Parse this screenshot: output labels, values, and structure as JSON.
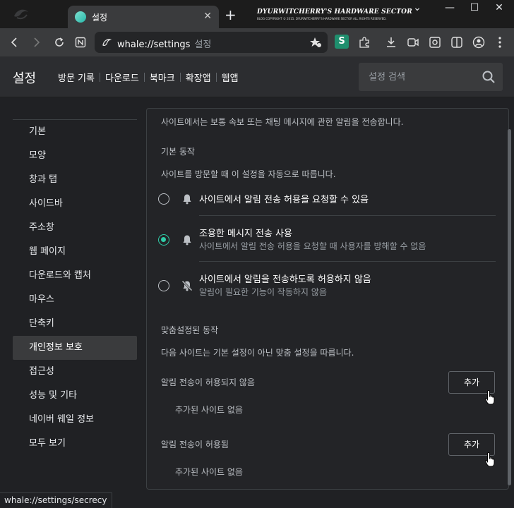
{
  "browser": {
    "tab_title": "설정",
    "new_tab": "+",
    "blog_banner_title": "DYURWITCHERRY'S HARDWARE SECTOR",
    "blog_banner_subtitle": "BLOG COPYRIGHT © 2015. DYURWITCHERRY'S HARDWARE SECTOR ALL RIGHTS RESERVED.",
    "url": "whale://settings",
    "url_hint": "설정",
    "ext_letter": "S",
    "status_url": "whale://settings/secrecy"
  },
  "header": {
    "title": "설정",
    "nav": [
      "방문 기록",
      "다운로드",
      "북마크",
      "확장앱",
      "웹앱"
    ],
    "search_placeholder": "설정 검색"
  },
  "sidebar": {
    "items": [
      {
        "label": "기본",
        "active": false
      },
      {
        "label": "모양",
        "active": false
      },
      {
        "label": "창과 탭",
        "active": false
      },
      {
        "label": "사이드바",
        "active": false
      },
      {
        "label": "주소창",
        "active": false
      },
      {
        "label": "웹 페이지",
        "active": false
      },
      {
        "label": "다운로드와 캡처",
        "active": false
      },
      {
        "label": "마우스",
        "active": false
      },
      {
        "label": "단축키",
        "active": false
      },
      {
        "label": "개인정보 보호",
        "active": true
      },
      {
        "label": "접근성",
        "active": false
      },
      {
        "label": "성능 및 기타",
        "active": false
      },
      {
        "label": "네이버 웨일 정보",
        "active": false
      },
      {
        "label": "모두 보기",
        "active": false
      }
    ]
  },
  "panel": {
    "intro": "사이트에서는 보통 속보 또는 채팅 메시지에 관한 알림을 전송합니다.",
    "default_behavior_title": "기본 동작",
    "default_behavior_desc": "사이트를 방문할 때 이 설정을 자동으로 따릅니다.",
    "options": [
      {
        "title": "사이트에서 알림 전송 허용을 요청할 수 있음",
        "desc": "",
        "checked": false,
        "icon": "bell-icon"
      },
      {
        "title": "조용한 메시지 전송 사용",
        "desc": "사이트에서 알림 전송 허용을 요청할 때 사용자를 방해할 수 없음",
        "checked": true,
        "icon": "bell-icon"
      },
      {
        "title": "사이트에서 알림을 전송하도록 허용하지 않음",
        "desc": "알림이 필요한 기능이 작동하지 않음",
        "checked": false,
        "icon": "bell-off-icon"
      }
    ],
    "custom_title": "맞춤설정된 동작",
    "custom_desc": "다음 사이트는 기본 설정이 아닌 맞춤 설정을 따릅니다.",
    "blocked": {
      "label": "알림 전송이 허용되지 않음",
      "button": "추가",
      "empty": "추가된 사이트 없음"
    },
    "allowed": {
      "label": "알림 전송이 허용됨",
      "button": "추가",
      "empty": "추가된 사이트 없음"
    }
  },
  "colors": {
    "accent": "#2fcca7",
    "background": "#202124",
    "panel": "#232427",
    "toolbar": "#3a3b3d"
  }
}
